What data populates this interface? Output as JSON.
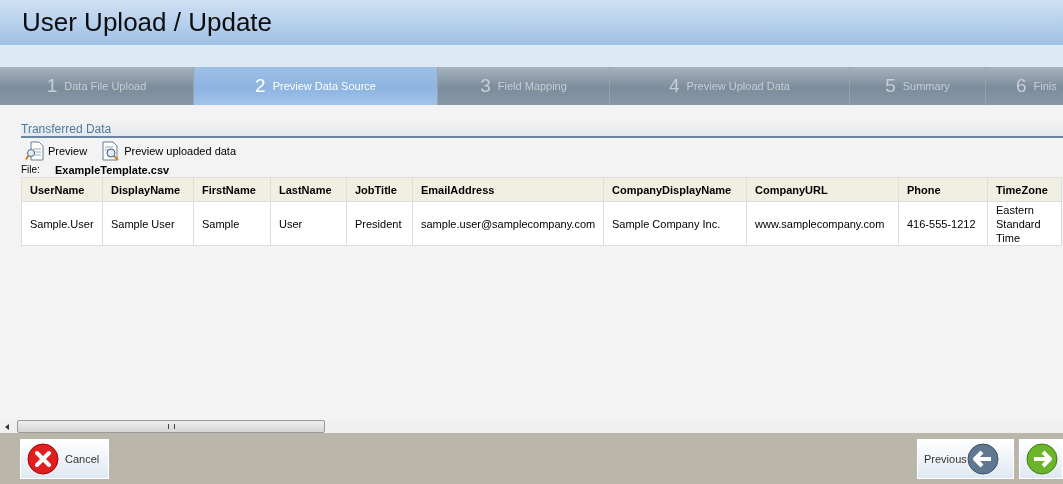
{
  "title": "User Upload / Update",
  "steps": [
    {
      "number": "1",
      "label": "Data File Upload",
      "selected": false
    },
    {
      "number": "2",
      "label": "Preview Data Source",
      "selected": true
    },
    {
      "number": "3",
      "label": "Field Mapping",
      "selected": false
    },
    {
      "number": "4",
      "label": "Preview Upload Data",
      "selected": false
    },
    {
      "number": "5",
      "label": "Summary",
      "selected": false
    },
    {
      "number": "6",
      "label": "Finis",
      "selected": false
    }
  ],
  "section_title": "Transferred Data",
  "toolbar": [
    {
      "label": "Preview",
      "kind": "preview"
    },
    {
      "label": "Preview uploaded data",
      "kind": "uploaded"
    }
  ],
  "file": {
    "label": "File:",
    "value": "ExampleTemplate.csv"
  },
  "table": {
    "columns": [
      "UserName",
      "DisplayName",
      "FirstName",
      "LastName",
      "JobTitle",
      "EmailAddress",
      "CompanyDisplayName",
      "CompanyURL",
      "Phone",
      "TimeZone"
    ],
    "rows": [
      [
        "Sample.User",
        "Sample User",
        "Sample",
        "User",
        "President",
        "sample.user@samplecompany.com",
        "Sample Company Inc.",
        "www.samplecompany.com",
        "416-555-1212",
        "Eastern Standard Time"
      ]
    ]
  },
  "footer": {
    "cancel": "Cancel",
    "previous": "Previous"
  }
}
